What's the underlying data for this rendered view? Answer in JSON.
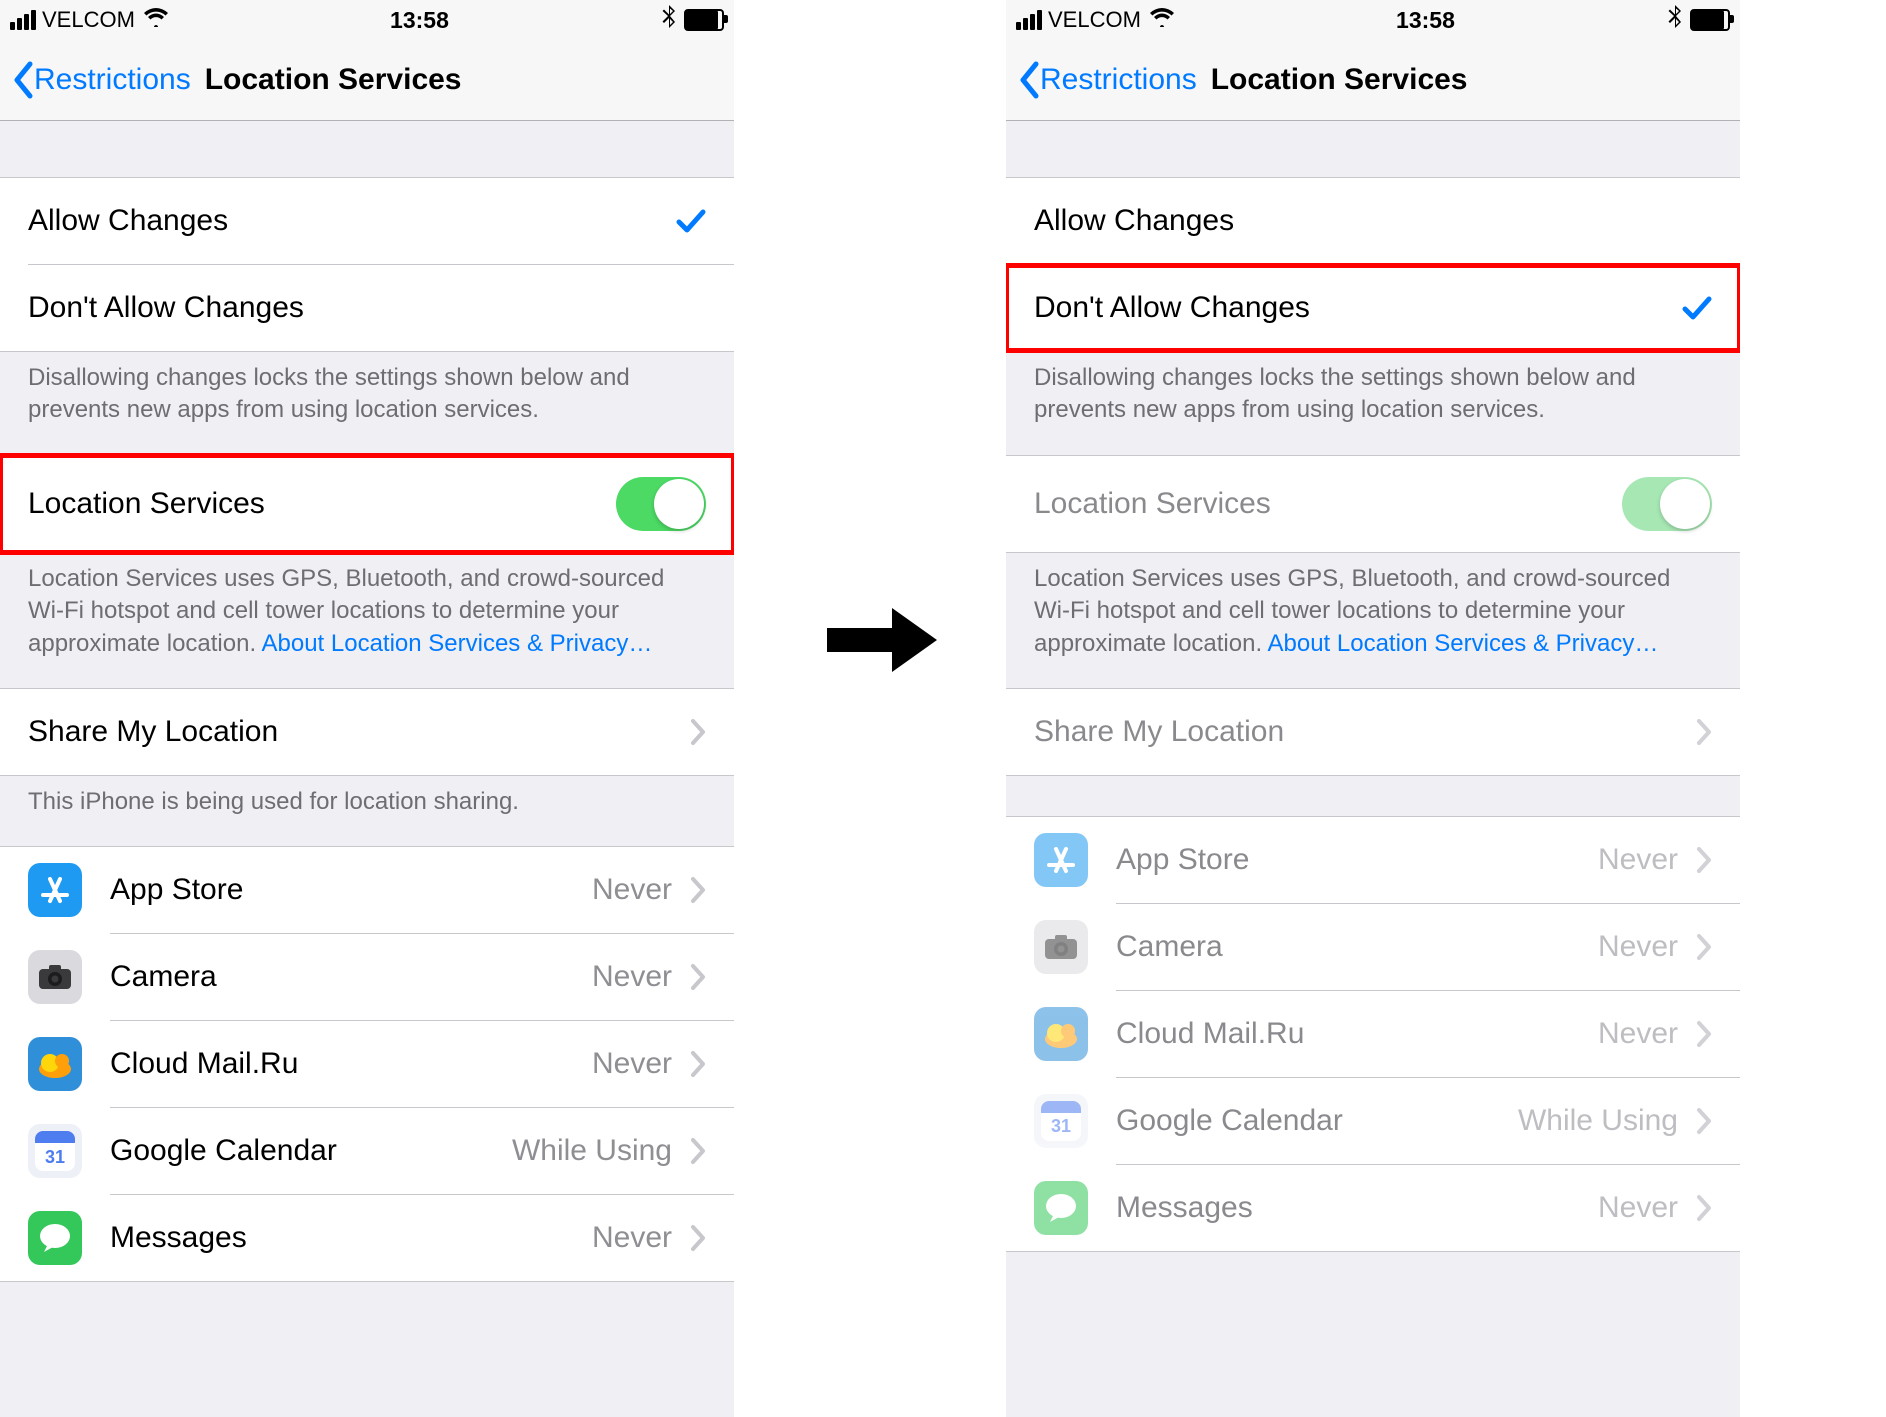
{
  "status": {
    "carrier": "VELCOM",
    "time": "13:58"
  },
  "nav": {
    "back": "Restrictions",
    "title": "Location Services"
  },
  "allow": {
    "allow": "Allow Changes",
    "dont": "Don't Allow Changes",
    "footer": "Disallowing changes locks the settings shown below and prevents new apps from using location services."
  },
  "locsvc": {
    "label": "Location Services",
    "footer": "Location Services uses GPS, Bluetooth, and crowd-sourced Wi-Fi hotspot and cell tower locations to determine your approximate location. ",
    "link": "About Location Services & Privacy…"
  },
  "share": {
    "label": "Share My Location",
    "footer": "This iPhone is being used for location sharing."
  },
  "apps": [
    {
      "name": "App Store",
      "status": "Never",
      "icon": "appstore"
    },
    {
      "name": "Camera",
      "status": "Never",
      "icon": "camera"
    },
    {
      "name": "Cloud Mail.Ru",
      "status": "Never",
      "icon": "cloud"
    },
    {
      "name": "Google Calendar",
      "status": "While Using",
      "icon": "gcal"
    },
    {
      "name": "Messages",
      "status": "Never",
      "icon": "messages"
    }
  ],
  "gcal_day": "31"
}
